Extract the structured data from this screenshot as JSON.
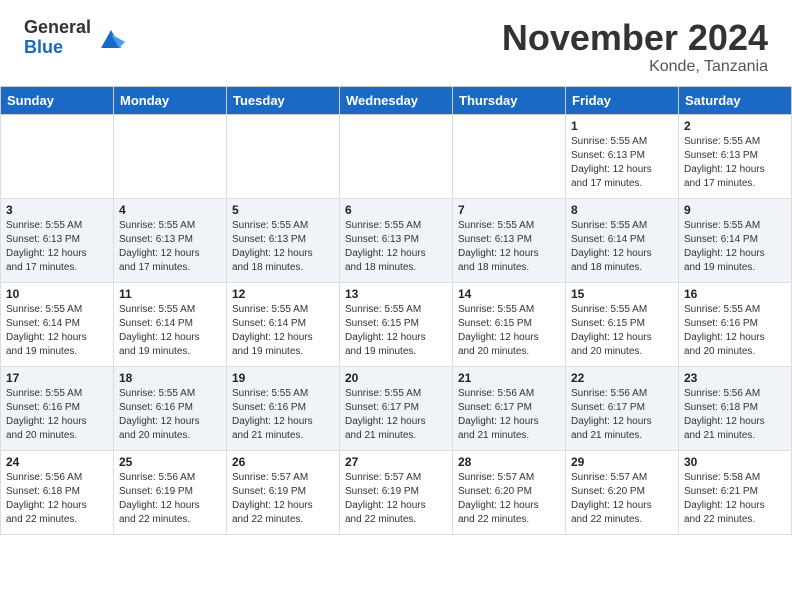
{
  "header": {
    "logo_general": "General",
    "logo_blue": "Blue",
    "month_title": "November 2024",
    "location": "Konde, Tanzania"
  },
  "weekdays": [
    "Sunday",
    "Monday",
    "Tuesday",
    "Wednesday",
    "Thursday",
    "Friday",
    "Saturday"
  ],
  "weeks": [
    [
      {
        "day": "",
        "info": ""
      },
      {
        "day": "",
        "info": ""
      },
      {
        "day": "",
        "info": ""
      },
      {
        "day": "",
        "info": ""
      },
      {
        "day": "",
        "info": ""
      },
      {
        "day": "1",
        "info": "Sunrise: 5:55 AM\nSunset: 6:13 PM\nDaylight: 12 hours\nand 17 minutes."
      },
      {
        "day": "2",
        "info": "Sunrise: 5:55 AM\nSunset: 6:13 PM\nDaylight: 12 hours\nand 17 minutes."
      }
    ],
    [
      {
        "day": "3",
        "info": "Sunrise: 5:55 AM\nSunset: 6:13 PM\nDaylight: 12 hours\nand 17 minutes."
      },
      {
        "day": "4",
        "info": "Sunrise: 5:55 AM\nSunset: 6:13 PM\nDaylight: 12 hours\nand 17 minutes."
      },
      {
        "day": "5",
        "info": "Sunrise: 5:55 AM\nSunset: 6:13 PM\nDaylight: 12 hours\nand 18 minutes."
      },
      {
        "day": "6",
        "info": "Sunrise: 5:55 AM\nSunset: 6:13 PM\nDaylight: 12 hours\nand 18 minutes."
      },
      {
        "day": "7",
        "info": "Sunrise: 5:55 AM\nSunset: 6:13 PM\nDaylight: 12 hours\nand 18 minutes."
      },
      {
        "day": "8",
        "info": "Sunrise: 5:55 AM\nSunset: 6:14 PM\nDaylight: 12 hours\nand 18 minutes."
      },
      {
        "day": "9",
        "info": "Sunrise: 5:55 AM\nSunset: 6:14 PM\nDaylight: 12 hours\nand 19 minutes."
      }
    ],
    [
      {
        "day": "10",
        "info": "Sunrise: 5:55 AM\nSunset: 6:14 PM\nDaylight: 12 hours\nand 19 minutes."
      },
      {
        "day": "11",
        "info": "Sunrise: 5:55 AM\nSunset: 6:14 PM\nDaylight: 12 hours\nand 19 minutes."
      },
      {
        "day": "12",
        "info": "Sunrise: 5:55 AM\nSunset: 6:14 PM\nDaylight: 12 hours\nand 19 minutes."
      },
      {
        "day": "13",
        "info": "Sunrise: 5:55 AM\nSunset: 6:15 PM\nDaylight: 12 hours\nand 19 minutes."
      },
      {
        "day": "14",
        "info": "Sunrise: 5:55 AM\nSunset: 6:15 PM\nDaylight: 12 hours\nand 20 minutes."
      },
      {
        "day": "15",
        "info": "Sunrise: 5:55 AM\nSunset: 6:15 PM\nDaylight: 12 hours\nand 20 minutes."
      },
      {
        "day": "16",
        "info": "Sunrise: 5:55 AM\nSunset: 6:16 PM\nDaylight: 12 hours\nand 20 minutes."
      }
    ],
    [
      {
        "day": "17",
        "info": "Sunrise: 5:55 AM\nSunset: 6:16 PM\nDaylight: 12 hours\nand 20 minutes."
      },
      {
        "day": "18",
        "info": "Sunrise: 5:55 AM\nSunset: 6:16 PM\nDaylight: 12 hours\nand 20 minutes."
      },
      {
        "day": "19",
        "info": "Sunrise: 5:55 AM\nSunset: 6:16 PM\nDaylight: 12 hours\nand 21 minutes."
      },
      {
        "day": "20",
        "info": "Sunrise: 5:55 AM\nSunset: 6:17 PM\nDaylight: 12 hours\nand 21 minutes."
      },
      {
        "day": "21",
        "info": "Sunrise: 5:56 AM\nSunset: 6:17 PM\nDaylight: 12 hours\nand 21 minutes."
      },
      {
        "day": "22",
        "info": "Sunrise: 5:56 AM\nSunset: 6:17 PM\nDaylight: 12 hours\nand 21 minutes."
      },
      {
        "day": "23",
        "info": "Sunrise: 5:56 AM\nSunset: 6:18 PM\nDaylight: 12 hours\nand 21 minutes."
      }
    ],
    [
      {
        "day": "24",
        "info": "Sunrise: 5:56 AM\nSunset: 6:18 PM\nDaylight: 12 hours\nand 22 minutes."
      },
      {
        "day": "25",
        "info": "Sunrise: 5:56 AM\nSunset: 6:19 PM\nDaylight: 12 hours\nand 22 minutes."
      },
      {
        "day": "26",
        "info": "Sunrise: 5:57 AM\nSunset: 6:19 PM\nDaylight: 12 hours\nand 22 minutes."
      },
      {
        "day": "27",
        "info": "Sunrise: 5:57 AM\nSunset: 6:19 PM\nDaylight: 12 hours\nand 22 minutes."
      },
      {
        "day": "28",
        "info": "Sunrise: 5:57 AM\nSunset: 6:20 PM\nDaylight: 12 hours\nand 22 minutes."
      },
      {
        "day": "29",
        "info": "Sunrise: 5:57 AM\nSunset: 6:20 PM\nDaylight: 12 hours\nand 22 minutes."
      },
      {
        "day": "30",
        "info": "Sunrise: 5:58 AM\nSunset: 6:21 PM\nDaylight: 12 hours\nand 22 minutes."
      }
    ]
  ]
}
